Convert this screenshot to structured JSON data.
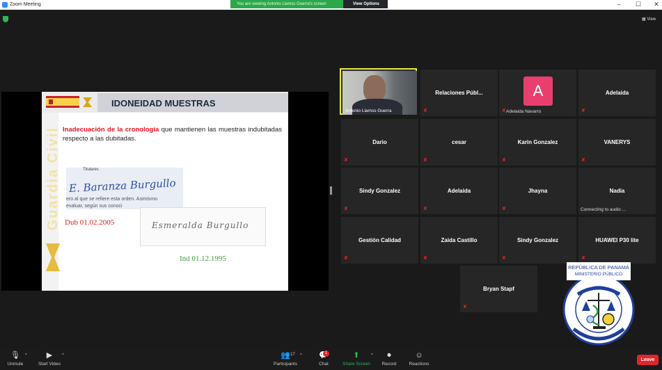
{
  "window": {
    "title": "Zoom Meeting"
  },
  "banner": {
    "message": "You are viewing Antonio Llamss Guerra's screen",
    "options_label": "View Options"
  },
  "view_toggle": {
    "label": "View"
  },
  "slide": {
    "title": "IDONEIDAD MUESTRAS",
    "vertical_text": "Guardia Civil",
    "para_red": "Inadecuación de la cronología",
    "para_rest": " que mantienen las muestras indubitadas respecto a las dubitadas.",
    "sig1_label": "Titulares",
    "sig1_hand": "E. Baranza Burgullo",
    "sig1_line1": "ero al que se refiere esta orden. Asimismo",
    "sig1_line2": "evaluar, según sus conoci",
    "sig2_hand": "Esmeralda  Burgullo",
    "date_dub": "Dub 01.02.2005",
    "date_ind": "Ind 01.12.1995"
  },
  "participants_grid": [
    {
      "name": "Antonio Llamss Guerra",
      "type": "video"
    },
    {
      "name": "Relaciones  Públ..."
    },
    {
      "name": "Adelaida Navarro",
      "type": "avatar",
      "initial": "A"
    },
    {
      "name": "Adelaida"
    },
    {
      "name": "Dario"
    },
    {
      "name": "cesar"
    },
    {
      "name": "Karin Gonzalez"
    },
    {
      "name": "VANERYS"
    },
    {
      "name": "Sindy Gonzalez"
    },
    {
      "name": "Adelaida"
    },
    {
      "name": "Jhayna"
    },
    {
      "name": "Nadia",
      "status": "Connecting to audio ..."
    },
    {
      "name": "Gestión Calidad"
    },
    {
      "name": "Zaida Castillo"
    },
    {
      "name": "Sindy Gonzalez"
    },
    {
      "name": "HUAWEI P30 lite"
    },
    {
      "name": "Bryan Stapf"
    }
  ],
  "seal": {
    "top_text": "REPÚBLICA DE PANAMÁ",
    "sub_text": "MINISTERIO PÚBLICO",
    "ring_text": "INSTITUTO DE MEDICINA LEGAL Y CIENCIAS FORENSES"
  },
  "toolbar": {
    "unmute": "Unmute",
    "start_video": "Start Video",
    "participants": "Participants",
    "participant_count": "17",
    "chat": "Chat",
    "chat_badge": "1",
    "share_screen": "Share Screen",
    "record": "Record",
    "reactions": "Reactions",
    "leave": "Leave"
  },
  "colors": {
    "share_green": "#2eb84f",
    "leave_red": "#e0252b",
    "active_border": "#e6e93d",
    "avatar_pink": "#e83f6f"
  }
}
